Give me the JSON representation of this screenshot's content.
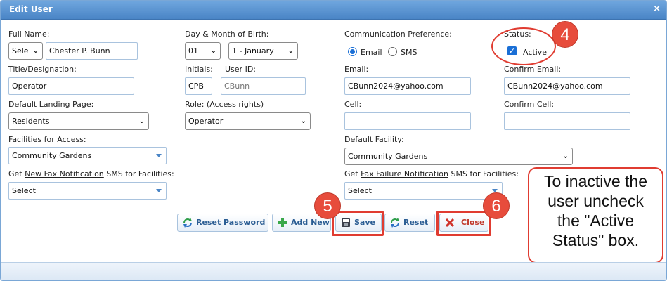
{
  "dialog": {
    "title": "Edit User",
    "close_symbol": "×"
  },
  "form": {
    "full_name": {
      "label": "Full Name:",
      "prefix_value": "Sele",
      "value": "Chester P. Bunn"
    },
    "dob": {
      "label": "Day & Month of Birth:",
      "day": "01",
      "month": "1 - January"
    },
    "comm_pref": {
      "label": "Communication Preference:",
      "options": [
        "Email",
        "SMS"
      ],
      "selected": "Email"
    },
    "status": {
      "label": "Status:",
      "checkbox_label": "Active",
      "checked": true
    },
    "title": {
      "label": "Title/Designation:",
      "value": "Operator"
    },
    "initials": {
      "label": "Initials:",
      "value": "CPB"
    },
    "user_id": {
      "label": "User ID:",
      "value": "CBunn"
    },
    "email": {
      "label": "Email:",
      "value": "CBunn2024@yahoo.com"
    },
    "confirm_email": {
      "label": "Confirm Email:",
      "value": "CBunn2024@yahoo.com"
    },
    "landing_page": {
      "label": "Default Landing Page:",
      "value": "Residents"
    },
    "role": {
      "label": "Role: (Access rights)",
      "value": "Operator"
    },
    "cell": {
      "label": "Cell:",
      "value": ""
    },
    "confirm_cell": {
      "label": "Confirm Cell:",
      "value": ""
    },
    "facilities_access": {
      "label": "Facilities for Access:",
      "value": "Community Gardens"
    },
    "default_facility": {
      "label": "Default Facility:",
      "value": "Community Gardens"
    },
    "fax_notif": {
      "label_pre": "Get ",
      "label_link": "New Fax Notification",
      "label_post": " SMS for Facilities:",
      "value": "Select"
    },
    "fax_fail": {
      "label_pre": "Get ",
      "label_link": "Fax Failure Notification",
      "label_post": " SMS for Facilities:",
      "value": "Select"
    }
  },
  "buttons": {
    "reset_password": "Reset Password",
    "add_new": "Add New",
    "save": "Save",
    "reset": "Reset",
    "close": "Close"
  },
  "annotations": {
    "step4": "4",
    "step5": "5",
    "step6": "6",
    "note_lines": [
      "To inactive the",
      "user uncheck",
      "the \"Active",
      "Status\" box."
    ]
  },
  "colors": {
    "title_bar": "#4a85c6",
    "annotation_red": "#e03c31",
    "radio_checkbox_blue": "#1a6fd6"
  }
}
